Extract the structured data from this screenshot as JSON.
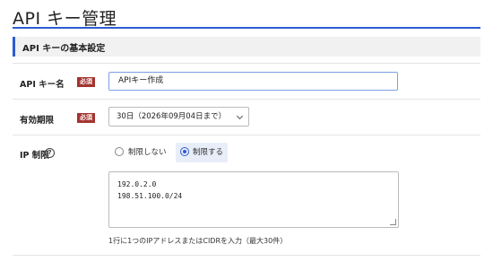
{
  "page": {
    "title": "API キー管理"
  },
  "section": {
    "title": "API キーの基本設定"
  },
  "fields": {
    "name": {
      "label": "API キー名",
      "required": "必須",
      "value": "APIキー作成"
    },
    "expiry": {
      "label": "有効期限",
      "required": "必須",
      "selected": "30日（2026年09月04日まで）"
    },
    "ip": {
      "label": "IP 制限",
      "help_icon": "?",
      "options": [
        {
          "label": "制限しない",
          "selected": false
        },
        {
          "label": "制限する",
          "selected": true
        }
      ],
      "addresses": [
        "192.0.2.0",
        "198.51.100.0/24"
      ],
      "hint": "1行に1つのIPアドレスまたはCIDRを入力（最大30件）"
    }
  },
  "colors": {
    "accent": "#2f5bd0",
    "required_badge": "#a3342f"
  }
}
